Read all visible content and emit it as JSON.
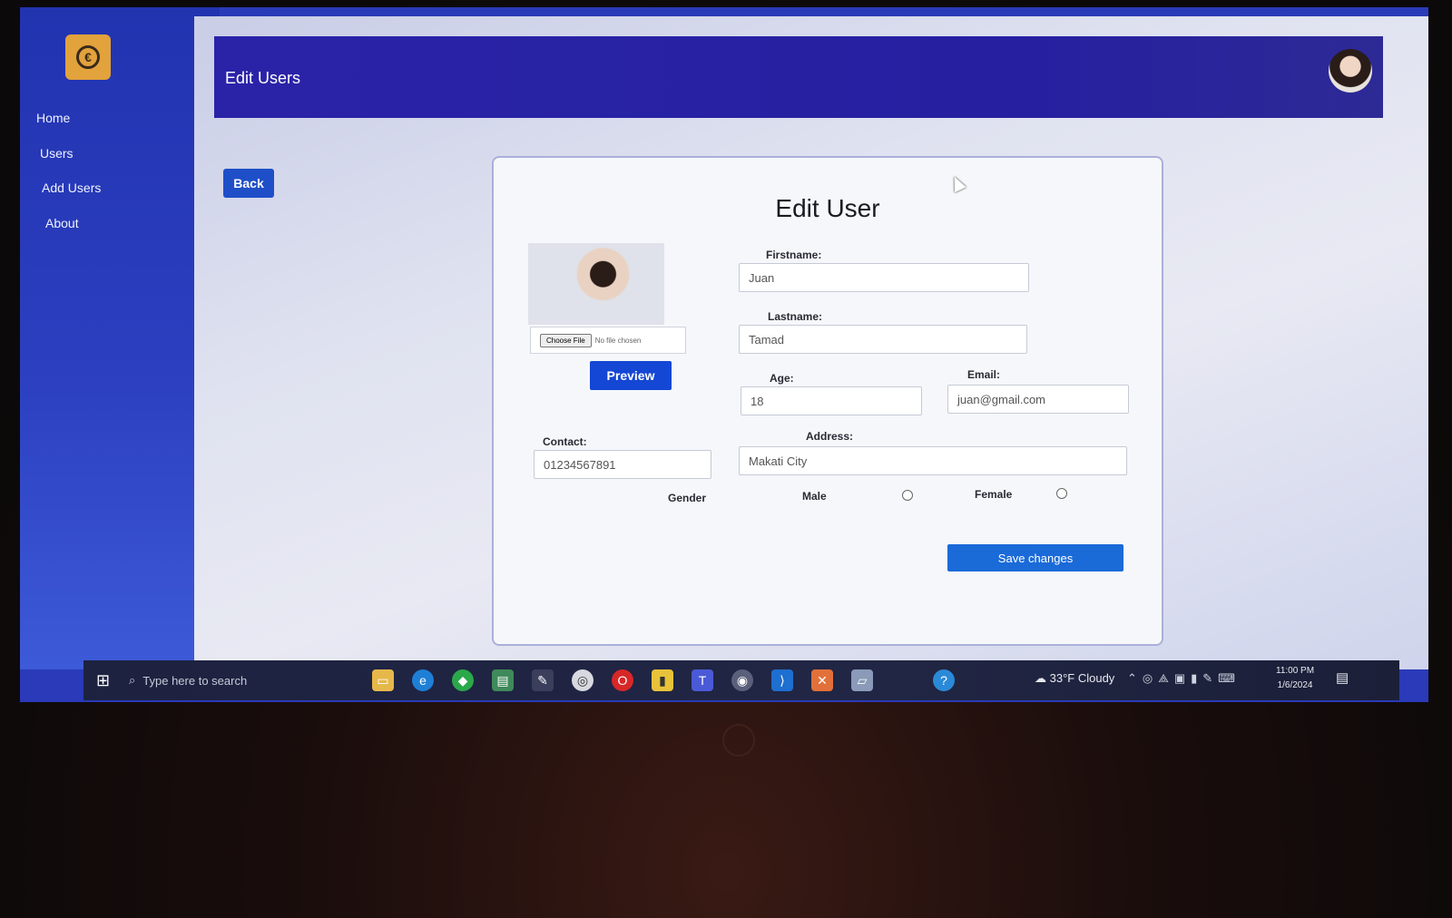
{
  "sidebar": {
    "logo_icon": "coin-logo-icon",
    "items": [
      {
        "label": "Home"
      },
      {
        "label": "Users"
      },
      {
        "label": "Add Users"
      },
      {
        "label": "About"
      }
    ]
  },
  "header": {
    "title": "Edit Users",
    "avatar_icon": "user-avatar"
  },
  "back_label": "Back",
  "form": {
    "title": "Edit User",
    "choose_file_label": "Choose File",
    "file_status": "No file chosen",
    "preview_label": "Preview",
    "firstname": {
      "label": "Firstname:",
      "value": "Juan"
    },
    "lastname": {
      "label": "Lastname:",
      "value": "Tamad"
    },
    "age": {
      "label": "Age:",
      "value": "18"
    },
    "email": {
      "label": "Email:",
      "value": "juan@gmail.com"
    },
    "contact": {
      "label": "Contact:",
      "value": "01234567891"
    },
    "address": {
      "label": "Address:",
      "value": "Makati City"
    },
    "gender": {
      "label": "Gender",
      "options": [
        "Male",
        "Female"
      ]
    },
    "save_label": "Save changes"
  },
  "taskbar": {
    "search_placeholder": "Type here to search",
    "weather": "33°F Cloudy",
    "time": "11:00 PM",
    "date": "1/6/2024"
  },
  "colors": {
    "sidebar": "#2b3fc0",
    "topbar": "#2620a0",
    "primary_button": "#1447d4",
    "logo": "#e2a23c"
  }
}
